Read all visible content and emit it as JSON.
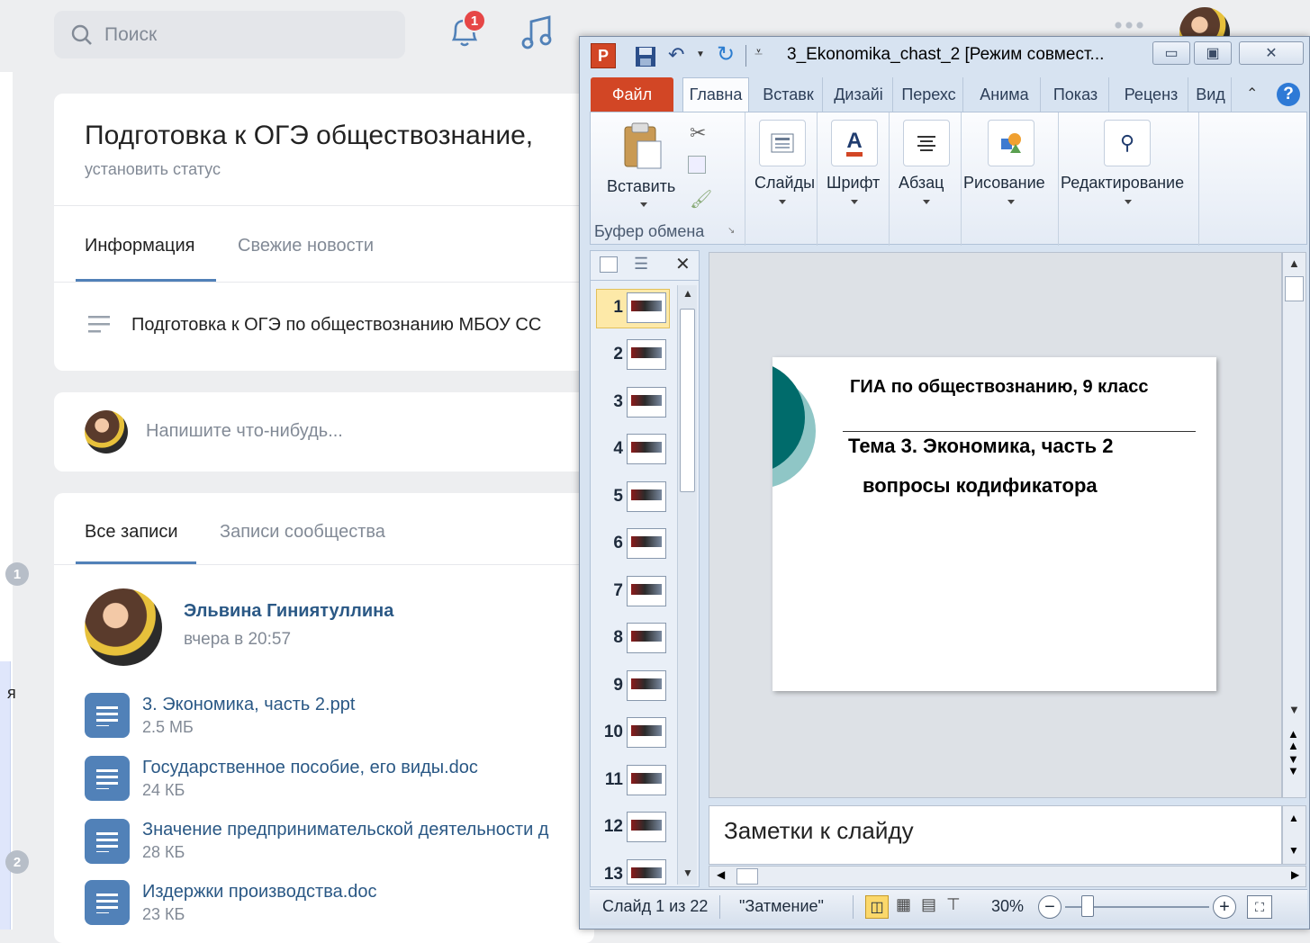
{
  "vk": {
    "search_placeholder": "Поиск",
    "notification_count": "1",
    "left_badges": [
      "1",
      "2"
    ],
    "left_text": "я",
    "group": {
      "title": "Подготовка к ОГЭ обществознание,",
      "status": "установить статус"
    },
    "info_tabs": [
      "Информация",
      "Свежие новости"
    ],
    "description": "Подготовка к ОГЭ по обществознанию МБОУ СС",
    "composer_placeholder": "Напишите что-нибудь...",
    "wall_tabs": [
      "Все записи",
      "Записи сообщества"
    ],
    "post": {
      "author": "Эльвина Гиниятуллина",
      "time": "вчера в 20:57",
      "docs": [
        {
          "name": "3. Экономика, часть 2.ppt",
          "size": "2.5 МБ"
        },
        {
          "name": "Государственное пособие, его виды.doc",
          "size": "24 КБ"
        },
        {
          "name": "Значение предпринимательской деятельности д",
          "size": "28 КБ"
        },
        {
          "name": "Издержки производства.doc",
          "size": "23 КБ"
        }
      ]
    }
  },
  "ppt": {
    "app_icon_letter": "P",
    "window_title": "3_Ekonomika_chast_2 [Режим совмест...",
    "tabs": [
      "Файл",
      "Главна",
      "Вставк",
      "Дизайі",
      "Перехс",
      "Анима",
      "Показ",
      "Реценз",
      "Вид"
    ],
    "ribbon": {
      "paste": "Вставить",
      "clipboard": "Буфер обмена",
      "slides": "Слайды",
      "font": "Шрифт",
      "paragraph": "Абзац",
      "drawing": "Рисование",
      "editing": "Редактирование"
    },
    "thumbnails": [
      "1",
      "2",
      "3",
      "4",
      "5",
      "6",
      "7",
      "8",
      "9",
      "10",
      "11",
      "12",
      "13"
    ],
    "slide": {
      "line1": "ГИА по обществознанию, 9 класс",
      "line2": "Тема 3. Экономика, часть 2",
      "line3": "вопросы кодификатора"
    },
    "notes_placeholder": "Заметки к слайду",
    "status": {
      "slide_info": "Слайд 1 из 22",
      "theme": "\"Затмение\"",
      "zoom": "30%"
    },
    "colors": {
      "file_tab": "#d24625",
      "accent": "#5181b8"
    }
  }
}
